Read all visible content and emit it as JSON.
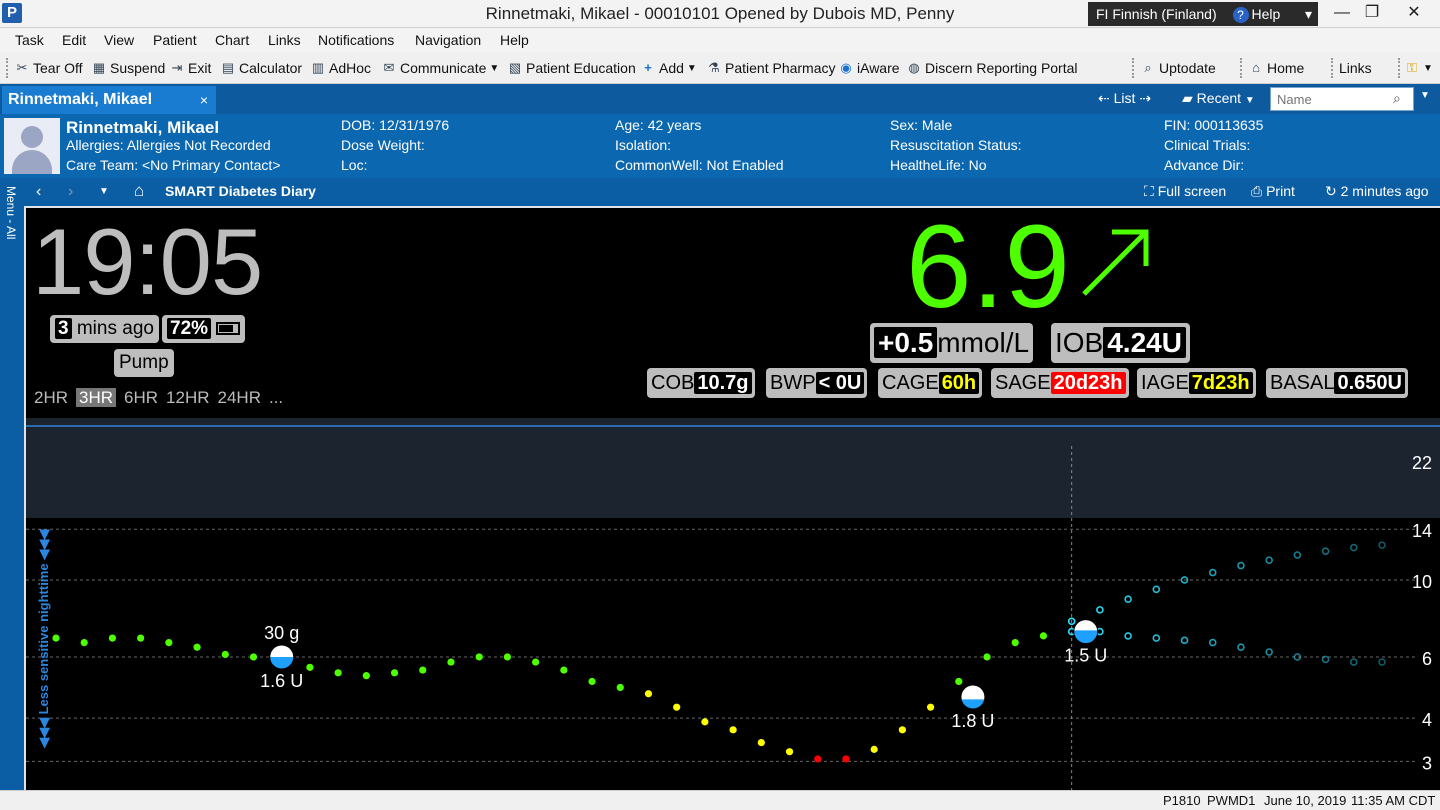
{
  "window": {
    "title": "Rinnetmaki, Mikael  - 00010101 Opened by Dubois MD, Penny",
    "language_flag": "FI",
    "language": "Finnish (Finland)",
    "help": "Help"
  },
  "menu": [
    "Task",
    "Edit",
    "View",
    "Patient",
    "Chart",
    "Links",
    "Notifications",
    "Navigation",
    "Help"
  ],
  "toolbar": {
    "tear_off": "Tear Off",
    "suspend": "Suspend",
    "exit": "Exit",
    "calculator": "Calculator",
    "adhoc": "AdHoc",
    "communicate": "Communicate",
    "patient_education": "Patient Education",
    "add": "Add",
    "patient_pharmacy": "Patient Pharmacy",
    "iaware": "iAware",
    "discern": "Discern Reporting Portal",
    "uptodate": "Uptodate",
    "home": "Home",
    "links": "Links"
  },
  "tabs": {
    "patient_tab": "Rinnetmaki, Mikael",
    "close": "×",
    "list": "List",
    "recent": "Recent",
    "name_placeholder": "Name"
  },
  "banner": {
    "name": "Rinnetmaki, Mikael",
    "allergies": "Allergies: Allergies Not Recorded",
    "care_team": "Care Team: <No Primary Contact>",
    "dob": "DOB: 12/31/1976",
    "dose_weight": "Dose Weight:",
    "loc": "Loc:",
    "age": "Age: 42 years",
    "isolation": "Isolation:",
    "commonwell": "CommonWell: Not Enabled",
    "sex": "Sex: Male",
    "resuscitation": "Resuscitation Status:",
    "healthelife": "HealtheLife: No",
    "fin": "FIN: 000113635",
    "clinical_trials": "Clinical Trials:",
    "advance_dir": "Advance Dir:"
  },
  "subbar": {
    "menu_label": "Menu - All",
    "page_title": "SMART Diabetes Diary",
    "full_screen": "Full screen",
    "print": "Print",
    "updated": "2 minutes ago"
  },
  "nightscout": {
    "time": "19:05",
    "ago_value": "3",
    "ago_label": "mins ago",
    "battery": "72%",
    "pump": "Pump",
    "ranges": [
      "2HR",
      "3HR",
      "6HR",
      "12HR",
      "24HR",
      "..."
    ],
    "selected_range": "3HR",
    "bg": "6.9",
    "delta": "+0.5",
    "units": "mmol/L",
    "iob_label": "IOB",
    "iob_value": "4.24U",
    "stats": [
      {
        "label": "COB",
        "value": "10.7g",
        "level": "normal"
      },
      {
        "label": "BWP",
        "value": "< 0U",
        "level": "normal"
      },
      {
        "label": "CAGE",
        "value": "60h",
        "level": "warn"
      },
      {
        "label": "SAGE",
        "value": "20d23h",
        "level": "urgent"
      },
      {
        "label": "IAGE",
        "value": "7d23h",
        "level": "warn"
      },
      {
        "label": "BASAL",
        "value": "0.650U",
        "level": "normal"
      }
    ],
    "nighttime_label": "Less sensitive nighttime"
  },
  "chart_data": {
    "type": "scatter",
    "y_ticks": [
      22,
      14,
      10,
      6,
      4,
      3
    ],
    "ylim": [
      2.6,
      24
    ],
    "y_scale": "log",
    "x_index_range": [
      0,
      47
    ],
    "now_index": 36,
    "series": [
      {
        "name": "",
        "kind": "measured",
        "points": [
          {
            "x": 0,
            "y": 6.8
          },
          {
            "x": 1,
            "y": 6.6
          },
          {
            "x": 2,
            "y": 6.8
          },
          {
            "x": 3,
            "y": 6.8
          },
          {
            "x": 4,
            "y": 6.6
          },
          {
            "x": 5,
            "y": 6.4
          },
          {
            "x": 6,
            "y": 6.1
          },
          {
            "x": 7,
            "y": 6.0
          },
          {
            "x": 8,
            "y": 5.9
          },
          {
            "x": 9,
            "y": 5.6
          },
          {
            "x": 10,
            "y": 5.4
          },
          {
            "x": 11,
            "y": 5.3
          },
          {
            "x": 12,
            "y": 5.4
          },
          {
            "x": 13,
            "y": 5.5
          },
          {
            "x": 14,
            "y": 5.8
          },
          {
            "x": 15,
            "y": 6.0
          },
          {
            "x": 16,
            "y": 6.0
          },
          {
            "x": 17,
            "y": 5.8
          },
          {
            "x": 18,
            "y": 5.5
          },
          {
            "x": 19,
            "y": 5.1
          },
          {
            "x": 20,
            "y": 4.9
          },
          {
            "x": 21,
            "y": 4.7
          },
          {
            "x": 22,
            "y": 4.3
          },
          {
            "x": 23,
            "y": 3.9
          },
          {
            "x": 24,
            "y": 3.7
          },
          {
            "x": 25,
            "y": 3.4
          },
          {
            "x": 26,
            "y": 3.2
          },
          {
            "x": 27,
            "y": 3.05
          },
          {
            "x": 28,
            "y": 3.05
          },
          {
            "x": 29,
            "y": 3.25
          },
          {
            "x": 30,
            "y": 3.7
          },
          {
            "x": 31,
            "y": 4.3
          },
          {
            "x": 32,
            "y": 5.1
          },
          {
            "x": 33,
            "y": 6.0
          },
          {
            "x": 34,
            "y": 6.6
          },
          {
            "x": 35,
            "y": 6.9
          }
        ]
      },
      {
        "name": "",
        "kind": "forecast-high",
        "points": [
          {
            "x": 36,
            "y": 7.6
          },
          {
            "x": 37,
            "y": 8.2
          },
          {
            "x": 38,
            "y": 8.8
          },
          {
            "x": 39,
            "y": 9.4
          },
          {
            "x": 40,
            "y": 10.0
          },
          {
            "x": 41,
            "y": 10.5
          },
          {
            "x": 42,
            "y": 11.0
          },
          {
            "x": 43,
            "y": 11.4
          },
          {
            "x": 44,
            "y": 11.8
          },
          {
            "x": 45,
            "y": 12.1
          },
          {
            "x": 46,
            "y": 12.4
          },
          {
            "x": 47,
            "y": 12.6
          }
        ]
      },
      {
        "name": "",
        "kind": "forecast-low",
        "points": [
          {
            "x": 36,
            "y": 7.1
          },
          {
            "x": 37,
            "y": 7.1
          },
          {
            "x": 38,
            "y": 6.9
          },
          {
            "x": 39,
            "y": 6.8
          },
          {
            "x": 40,
            "y": 6.7
          },
          {
            "x": 41,
            "y": 6.6
          },
          {
            "x": 42,
            "y": 6.4
          },
          {
            "x": 43,
            "y": 6.2
          },
          {
            "x": 44,
            "y": 6.0
          },
          {
            "x": 45,
            "y": 5.9
          },
          {
            "x": 46,
            "y": 5.8
          },
          {
            "x": 47,
            "y": 5.8
          }
        ]
      }
    ],
    "treatments": [
      {
        "x": 8,
        "y": 6.0,
        "insulin": "1.6 U",
        "carbs": "30 g",
        "fill": 0.5
      },
      {
        "x": 32.5,
        "y": 4.6,
        "insulin": "1.8 U",
        "carbs": "",
        "fill": 0.4
      },
      {
        "x": 36.5,
        "y": 7.1,
        "insulin": "1.5 U",
        "carbs": "",
        "fill": 0.55
      }
    ],
    "colors": {
      "in_range": "#4eff00",
      "warn": "#ffff00",
      "urgent": "#ff0000",
      "forecast": "#28e0ff",
      "insulin": "#1ea0ff"
    }
  },
  "statusbar": {
    "code1": "P1810",
    "code2": "PWMD1",
    "date": "June 10, 2019",
    "time": "11:35 AM CDT"
  }
}
